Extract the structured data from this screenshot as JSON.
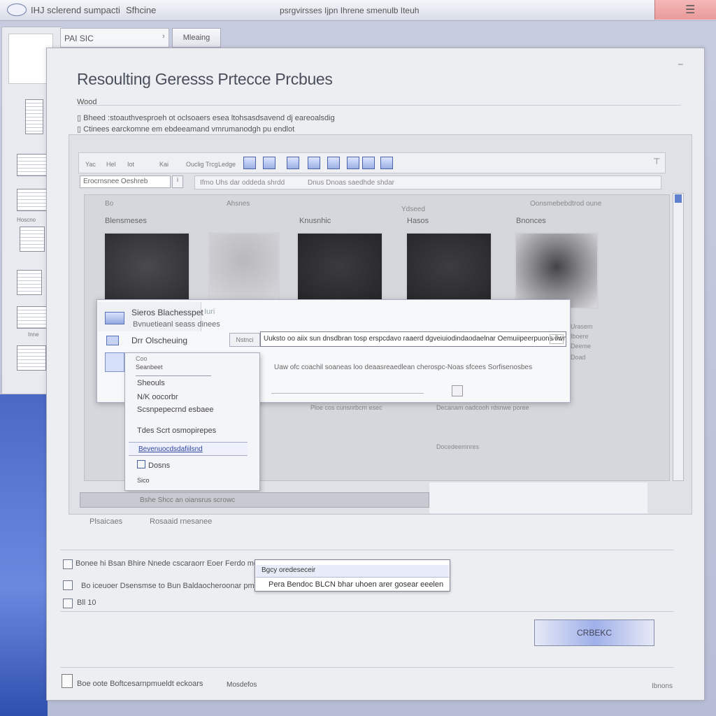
{
  "titlebar": {
    "left": "IHJ sclerend sumpacti",
    "mid": "Sfhcine",
    "center": "psrgvirsses Ijpn Ihrene smenulb Iteuh",
    "close_glyph": "☰"
  },
  "pathbar": {
    "path": "PAI SIC",
    "navigate_label": "Mleaing"
  },
  "thumbs": {
    "caption_1": "Hoscno",
    "caption_2": "Inne"
  },
  "dialog": {
    "title": "Resoulting Geresss Prtecce Prcbues",
    "section_label": "Wood",
    "option_1": "Bheed :stoauthvesproeh ot oclsoaers esea ltohsasdsavend dj eareoalsdig",
    "option_2": "Ctinees earckomne em ebdeeamand vmrumanodgh pu endlot"
  },
  "inner": {
    "toolbar_labels": [
      "Yac",
      "Hel",
      "Iot",
      "Kai",
      "Ouclig",
      "Trcg",
      "Ledge"
    ],
    "combo_value": "Erocrnsnee Oeshreb",
    "combo_btn": "i",
    "address_text_1": "Ifmo Uhs dar oddeda shrdd",
    "address_text_2": "Dnus Dnoas saedhde shdar",
    "gallery_head_1": "Bo",
    "gallery_head_2": "Ahsnes",
    "gallery_head_3": "Ydseed",
    "gallery_head_4": "Oonsmebebdtrod oune",
    "categories": [
      "Blensmeses",
      "Knusnhic",
      "Hasos",
      "Bnonces"
    ],
    "right_texts": [
      "Urasem",
      "Iboere",
      "Deeme",
      "Doad"
    ],
    "status_text": "Bshe Shcc an oiansrus scrowc",
    "foot_1": "Plsaicaes",
    "foot_2": "Rosaaid rnesanee",
    "lower_texts": [
      "Ploe cos cunsnrbcm esec",
      "Decanam oadcooh rdsnwe poree",
      "Docedeemnres"
    ]
  },
  "popup": {
    "title": "Sieros Blachesspet",
    "subtitle": "Bvnuetieanl seass dinees",
    "tag": "Iuri",
    "row_label": "Drr Olscheuing",
    "field_label": "Nstnci",
    "field_value": "Uuksto oo aiix sun dnsdbran tosp erspcdavo raaerd dgveiuiodindaodaelnar Oemuiipeerpuons ilwnatonsd",
    "field_btn": "vod",
    "description": "Uaw ofc coachil soaneas loo deaasreaedlean cherospc-Noas sfcees Sorfisenosbes",
    "menu": {
      "header": "Coo",
      "input_value": "Seanbeet",
      "items": [
        "Sheouls",
        "N/K oocorbr",
        "Scsnpepecrnd esbaee",
        "Tdes Scrt osmopirepes"
      ],
      "selected": "Bevenuocdsdafiilsnd",
      "items_after": [
        "Dosns",
        "Sico"
      ]
    }
  },
  "bottom": {
    "line_1": "Bonee hi Bsan Bhire Nnede cscaraorr Eoer Ferdo meesens Alaeanvs llnc eseseruc obr",
    "line_2": "Bo iceuoer Dsensmse to Bun Baldaocheroonar pmesse",
    "line_3": "Bll 10",
    "combo_selected": "Bgcy oredeseceir",
    "combo_text": "Pera Bendoc BLCN bhar uhoen arer gosear eeelen",
    "cancel_label": "CRBEKC"
  },
  "footer": {
    "text": "Boe oote Boftcesarnpmueldt eckoars",
    "mid": "Mosdefos",
    "right": "Ibnons"
  },
  "colors": {
    "accent": "#4f6cc4",
    "close": "#e99a9a",
    "desktop": "#4a69c6"
  }
}
